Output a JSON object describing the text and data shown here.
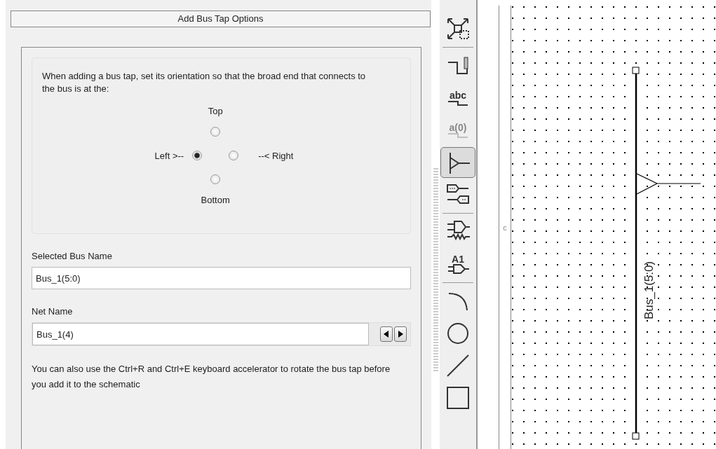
{
  "panel": {
    "title": "Add Bus Tap Options",
    "instructions": "When adding a bus tap, set its orientation so that the broad end that connects to the bus is at the:",
    "orientations": [
      {
        "kind": "top",
        "label": "Top",
        "selected": false
      },
      {
        "kind": "left",
        "label": "Left >--",
        "selected": true
      },
      {
        "kind": "right",
        "label": "--< Right",
        "selected": false
      },
      {
        "kind": "bottom",
        "label": "Bottom",
        "selected": false
      }
    ],
    "selected_bus": {
      "label": "Selected Bus Name",
      "value": "Bus_1(5:0)"
    },
    "net_name": {
      "label": "Net Name",
      "value": "Bus_1(4)"
    },
    "hint": "You can also use the Ctrl+R and Ctrl+E keyboard accelerator to rotate the bus tap before you add it to the schematic"
  },
  "toolbar": [
    {
      "kind": "zoom-fit",
      "selected": false,
      "disabled": false
    },
    {
      "kind": "separator"
    },
    {
      "kind": "wire",
      "selected": false,
      "disabled": false
    },
    {
      "kind": "net-label",
      "label": "abc",
      "selected": false,
      "disabled": false
    },
    {
      "kind": "net-label",
      "label": "a(0)",
      "selected": false,
      "disabled": true
    },
    {
      "kind": "bus-tap",
      "selected": true,
      "disabled": false
    },
    {
      "kind": "io-marker",
      "selected": false,
      "disabled": false
    },
    {
      "kind": "separator"
    },
    {
      "kind": "symbol",
      "selected": false,
      "disabled": false
    },
    {
      "kind": "symbol-label",
      "label": "A1",
      "selected": false,
      "disabled": false
    },
    {
      "kind": "separator"
    },
    {
      "kind": "arc",
      "selected": false,
      "disabled": false
    },
    {
      "kind": "circle",
      "selected": false,
      "disabled": false
    },
    {
      "kind": "line",
      "selected": false,
      "disabled": false
    },
    {
      "kind": "rectangle",
      "selected": false,
      "disabled": false
    }
  ],
  "canvas": {
    "ruler_mark": "c",
    "bus_label": "Bus_1(5:0)"
  }
}
